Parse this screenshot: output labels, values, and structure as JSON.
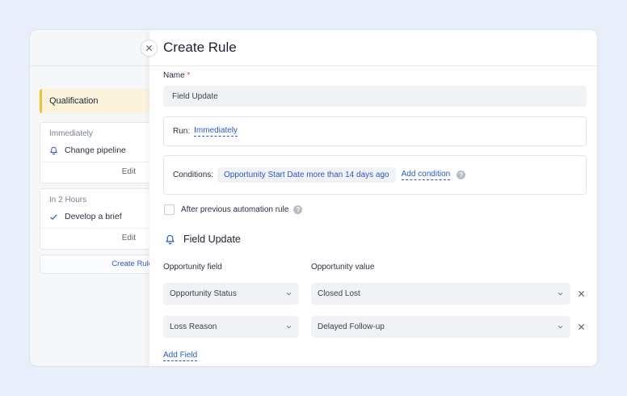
{
  "left_panel": {
    "stage_label": "Qualification",
    "cards": [
      {
        "when": "Immediately",
        "action": "Change pipeline",
        "action_icon": "bell-icon",
        "edit_label": "Edit"
      },
      {
        "when": "In 2 Hours",
        "action": "Develop a brief",
        "action_icon": "check-icon",
        "edit_label": "Edit"
      }
    ],
    "create_rule_label": "Create Rule"
  },
  "drawer": {
    "title": "Create Rule",
    "name_label": "Name",
    "required_mark": "*",
    "name_value": "Field Update",
    "run_label": "Run:",
    "run_value": "Immediately",
    "conditions_label": "Conditions:",
    "condition_chip": "Opportunity Start Date more than 14 days ago",
    "add_condition_label": "Add condition",
    "after_previous_label": "After previous automation rule",
    "after_previous_checked": false,
    "section_title": "Field Update",
    "col_field_header": "Opportunity field",
    "col_value_header": "Opportunity value",
    "rows": [
      {
        "field": "Opportunity Status",
        "value": "Closed Lost"
      },
      {
        "field": "Loss Reason",
        "value": "Delayed Follow-up"
      }
    ],
    "add_field_label": "Add Field",
    "help_glyph": "?"
  },
  "colors": {
    "accent": "#2c57c2",
    "stage_bg": "#fbf3dc",
    "stage_border": "#f0c138",
    "required": "#e0424b",
    "page_bg": "#e9eefb"
  }
}
